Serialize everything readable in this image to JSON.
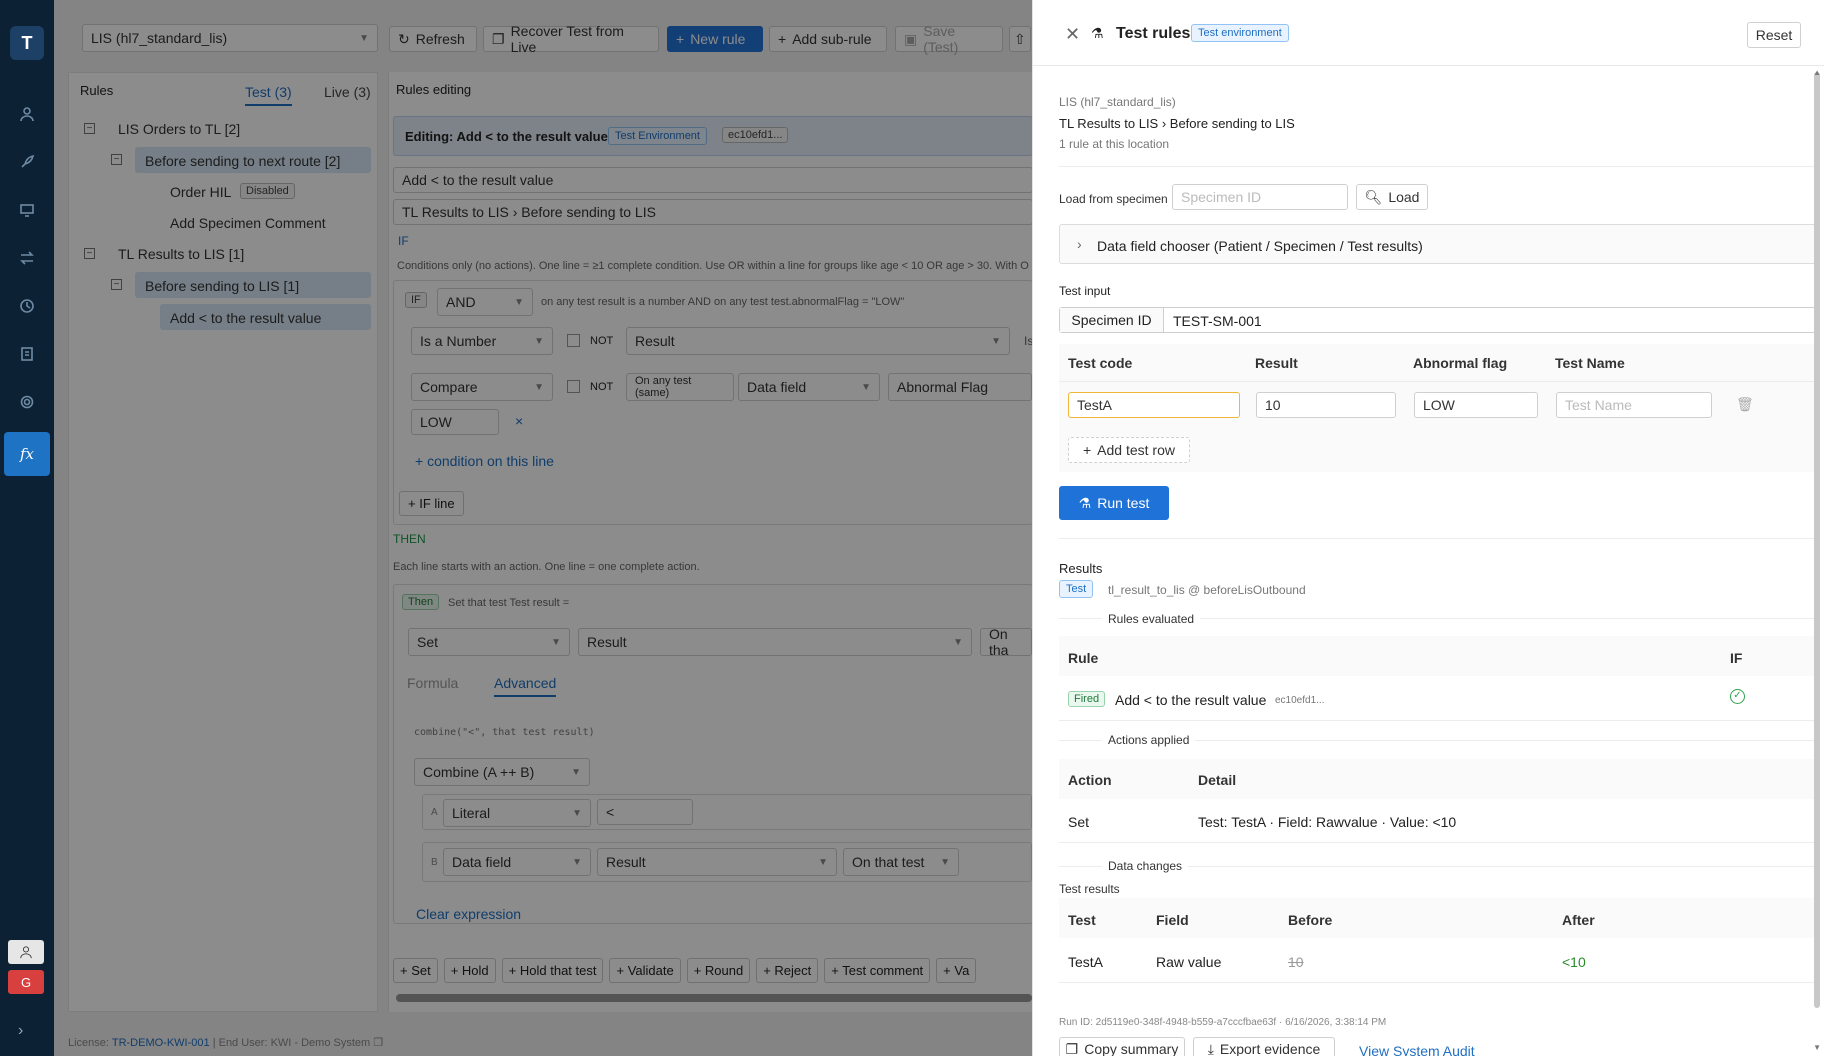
{
  "nav": {
    "logo": "T"
  },
  "toolbar": {
    "select": "LIS (hl7_standard_lis)",
    "refresh": "Refresh",
    "recover": "Recover Test from Live",
    "new_rule": "New rule",
    "add_sub": "Add sub-rule",
    "save": "Save (Test)"
  },
  "rules": {
    "title": "Rules",
    "tab_test": "Test (3)",
    "tab_live": "Live (3)",
    "tree": [
      "LIS Orders to TL [2]",
      "Before sending to next route [2]",
      "Order HIL",
      "Add Specimen Comment",
      "TL Results to LIS [1]",
      "Before sending to LIS [1]",
      "Add < to the result value"
    ],
    "disabled": "Disabled"
  },
  "editor": {
    "title": "Rules editing",
    "editing": "Editing: Add < to the result value",
    "env_tag": "Test Environment",
    "hash": "ec10efd1...",
    "name": "Add < to the result value",
    "location": "TL Results to LIS › Before sending to LIS",
    "if": "IF",
    "if_help": "Conditions only (no actions). One line = ≥1 complete condition. Use OR within a line for groups like age < 10 OR age > 30. With O",
    "if_tag": "IF",
    "and": "AND",
    "if_summary": "on any test result is a number AND on any test test.abnormalFlag = \"LOW\"",
    "c1": "Is a Number",
    "not": "NOT",
    "result": "Result",
    "is": "Is",
    "c2": "Compare",
    "on_any": "On any test (same)",
    "data_field": "Data field",
    "abn": "Abnormal Flag",
    "low": "LOW",
    "x": "×",
    "add_cond": "+ condition on this line",
    "if_line": "+ IF line",
    "then": "THEN",
    "then_help": "Each line starts with an action. One line = one complete action.",
    "then_tag": "Then",
    "then_summary": "Set that test Test result =",
    "set": "Set",
    "result2": "Result",
    "on_that": "On tha",
    "formula": "Formula",
    "advanced": "Advanced",
    "code": "combine(\"<\", that test result)",
    "combine": "Combine (A ++ B)",
    "a": "A",
    "literal": "Literal",
    "lt": "<",
    "b": "B",
    "data_field2": "Data field",
    "result3": "Result",
    "on_that_test": "On that test",
    "clear": "Clear expression",
    "actions": [
      "+ Set",
      "+ Hold",
      "+ Hold that test",
      "+ Validate",
      "+ Round",
      "+ Reject",
      "+ Test comment",
      "+ Va"
    ]
  },
  "footer": {
    "license_label": "License:",
    "license": "TR-DEMO-KWI-001",
    "rest": "| End User: KWI - Demo System"
  },
  "panel": {
    "title": "Test rules",
    "env": "Test environment",
    "reset": "Reset",
    "source": "LIS (hl7_standard_lis)",
    "path": "TL Results to LIS › Before sending to LIS",
    "count": "1 rule at this location",
    "load_label": "Load from specimen",
    "specimen_ph": "Specimen ID",
    "load": "Load",
    "chooser": "Data field chooser (Patient / Specimen / Test results)",
    "test_input": "Test input",
    "spec_label": "Specimen ID",
    "spec_val": "TEST-SM-001",
    "cols": [
      "Test code",
      "Result",
      "Abnormal flag",
      "Test Name"
    ],
    "row": {
      "code": "TestA",
      "result": "10",
      "flag": "LOW",
      "name_ph": "Test Name"
    },
    "add_row": "Add test row",
    "run": "Run test",
    "results": "Results",
    "res_tag": "Test",
    "res_src": "tl_result_to_lis @ beforeLisOutbound",
    "rules_eval": "Rules evaluated",
    "rule_col": "Rule",
    "if_col": "IF",
    "fired": "Fired",
    "rule_name": "Add < to the result value",
    "rule_hash": "ec10efd1...",
    "actions_applied": "Actions applied",
    "action_col": "Action",
    "detail_col": "Detail",
    "action": "Set",
    "detail": "Test: TestA · Field: Rawvalue · Value: <10",
    "data_changes": "Data changes",
    "test_results": "Test results",
    "dc_cols": [
      "Test",
      "Field",
      "Before",
      "After"
    ],
    "dc_row": {
      "test": "TestA",
      "field": "Raw value",
      "before": "10",
      "after": "<10"
    },
    "run_id": "Run ID: 2d5119e0-348f-4948-b559-a7cccfbae63f · 6/16/2026, 3:38:14 PM",
    "copy": "Copy summary",
    "export": "Export evidence",
    "audit": "View System Audit"
  }
}
